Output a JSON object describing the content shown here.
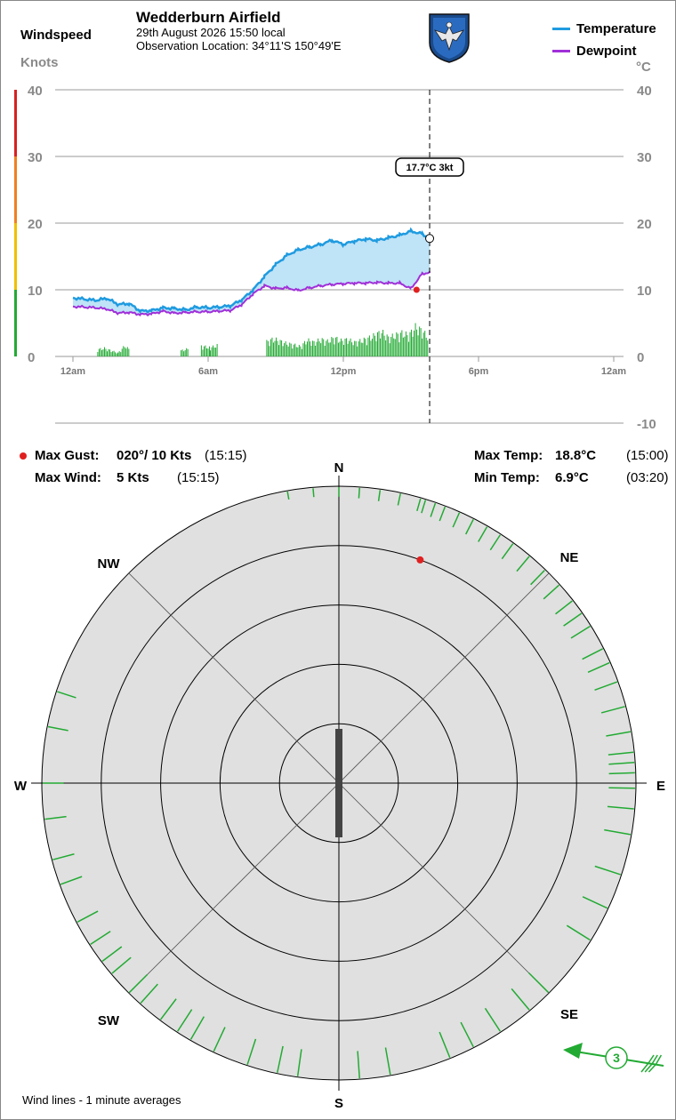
{
  "header": {
    "windspeed_label": "Windspeed",
    "knots_label": "Knots",
    "station_name": "Wedderburn Airfield",
    "date_time": "29th August 2026  15:50 local",
    "location": "Observation Location: 34°11'S 150°49'E",
    "logo_icon": "eagle-emblem-icon"
  },
  "legend": [
    {
      "name": "Temperature",
      "color": "#1f9be0"
    },
    {
      "name": "Dewpoint",
      "color": "#a030d8"
    }
  ],
  "colors": {
    "temperature": "#1f9be0",
    "dewpoint": "#a030d8",
    "fill": "#bfe3f7",
    "wind_bars": "#22aa33",
    "gust": "#e02020",
    "scale_green": "#22aa33",
    "scale_yellow": "#f0c000",
    "scale_orange": "#f08020",
    "scale_red": "#d82020"
  },
  "chart_data": {
    "type": "line",
    "left_axis": {
      "label": "Knots",
      "range": [
        0,
        40
      ],
      "ticks": [
        "0",
        "10",
        "20",
        "30",
        "40"
      ]
    },
    "right_axis": {
      "unit": "°C",
      "range": [
        -10,
        40
      ],
      "ticks": [
        "-10",
        "0",
        "10",
        "20",
        "30",
        "40"
      ]
    },
    "x_ticks": [
      "12am",
      "6am",
      "12pm",
      "6pm",
      "12am"
    ],
    "x_tick_hours": [
      0,
      6,
      12,
      18,
      24
    ],
    "current_hour": 15.83,
    "tooltip": "17.7°C  3kt",
    "grid": true,
    "series": [
      {
        "name": "Temperature",
        "points": [
          [
            0,
            8.8
          ],
          [
            0.5,
            8.6
          ],
          [
            1,
            8.4
          ],
          [
            1.5,
            8.7
          ],
          [
            2,
            7.8
          ],
          [
            2.5,
            7.9
          ],
          [
            3,
            6.8
          ],
          [
            3.5,
            6.9
          ],
          [
            4,
            7.3
          ],
          [
            4.5,
            7.2
          ],
          [
            5,
            7.0
          ],
          [
            5.5,
            7.4
          ],
          [
            6,
            7.3
          ],
          [
            6.5,
            7.4
          ],
          [
            7,
            7.6
          ],
          [
            7.5,
            8.5
          ],
          [
            8,
            10.0
          ],
          [
            8.5,
            12.0
          ],
          [
            9,
            13.8
          ],
          [
            9.5,
            15.2
          ],
          [
            10,
            16.0
          ],
          [
            10.5,
            16.4
          ],
          [
            11,
            16.8
          ],
          [
            11.5,
            17.4
          ],
          [
            12,
            16.8
          ],
          [
            12.5,
            17.3
          ],
          [
            13,
            17.6
          ],
          [
            13.5,
            17.4
          ],
          [
            14,
            17.8
          ],
          [
            14.5,
            18.2
          ],
          [
            15,
            18.8
          ],
          [
            15.5,
            18.4
          ],
          [
            15.83,
            17.7
          ]
        ]
      },
      {
        "name": "Dewpoint",
        "points": [
          [
            0,
            7.5
          ],
          [
            0.5,
            7.4
          ],
          [
            1,
            7.3
          ],
          [
            1.5,
            7.1
          ],
          [
            2,
            6.5
          ],
          [
            2.5,
            6.6
          ],
          [
            3,
            6.3
          ],
          [
            3.5,
            6.4
          ],
          [
            4,
            6.8
          ],
          [
            4.5,
            6.5
          ],
          [
            5,
            6.6
          ],
          [
            5.5,
            6.7
          ],
          [
            6,
            6.7
          ],
          [
            6.5,
            6.8
          ],
          [
            7,
            6.9
          ],
          [
            7.5,
            7.8
          ],
          [
            8,
            9.4
          ],
          [
            8.5,
            10.6
          ],
          [
            9,
            10.2
          ],
          [
            9.5,
            10.3
          ],
          [
            10,
            9.9
          ],
          [
            10.5,
            10.3
          ],
          [
            11,
            10.6
          ],
          [
            11.5,
            10.8
          ],
          [
            12,
            10.9
          ],
          [
            12.5,
            11.0
          ],
          [
            13,
            11.0
          ],
          [
            13.5,
            11.1
          ],
          [
            14,
            11.0
          ],
          [
            14.5,
            11.0
          ],
          [
            15,
            10.2
          ],
          [
            15.5,
            12.4
          ],
          [
            15.83,
            12.6
          ]
        ]
      },
      {
        "name": "Wind",
        "points": [
          [
            1.1,
            1.2
          ],
          [
            1.4,
            1.4
          ],
          [
            1.7,
            1.0
          ],
          [
            2.0,
            0.6
          ],
          [
            2.3,
            1.8
          ],
          [
            2.5,
            1.2
          ],
          [
            4.8,
            1.0
          ],
          [
            5.1,
            1.3
          ],
          [
            5.7,
            1.8
          ],
          [
            6.1,
            1.5
          ],
          [
            6.4,
            1.9
          ],
          [
            8.6,
            2.5
          ],
          [
            8.9,
            3.0
          ],
          [
            9.2,
            2.6
          ],
          [
            9.5,
            2.2
          ],
          [
            9.8,
            2.0
          ],
          [
            10.1,
            1.7
          ],
          [
            10.4,
            2.8
          ],
          [
            10.7,
            2.4
          ],
          [
            11,
            2.9
          ],
          [
            11.3,
            2.6
          ],
          [
            11.6,
            3.2
          ],
          [
            11.9,
            2.7
          ],
          [
            12.2,
            2.9
          ],
          [
            12.5,
            2.4
          ],
          [
            12.8,
            2.7
          ],
          [
            13.1,
            3.1
          ],
          [
            13.4,
            3.6
          ],
          [
            13.7,
            4.2
          ],
          [
            14.0,
            3.2
          ],
          [
            14.3,
            3.6
          ],
          [
            14.6,
            4.0
          ],
          [
            14.9,
            3.6
          ],
          [
            15.2,
            5.0
          ],
          [
            15.5,
            4.4
          ],
          [
            15.75,
            3.3
          ]
        ]
      }
    ],
    "gust_point": [
      15.25,
      10
    ],
    "stats": {
      "max_gust_label": "Max Gust:",
      "max_gust_value": "020°/ 10 Kts",
      "max_gust_time": "(15:15)",
      "max_wind_label": "Max Wind:",
      "max_wind_value": "5 Kts",
      "max_wind_time": "(15:15)",
      "max_temp_label": "Max Temp:",
      "max_temp_value": "18.8°C",
      "max_temp_time": "(15:00)",
      "min_temp_label": "Min Temp:",
      "min_temp_value": "6.9°C",
      "min_temp_time": "(03:20)"
    },
    "compass": {
      "labels": {
        "n": "N",
        "ne": "NE",
        "e": "E",
        "se": "SE",
        "s": "S",
        "sw": "SW",
        "w": "W",
        "nw": "NW"
      },
      "rings_knots": [
        2,
        4,
        6,
        8,
        10
      ],
      "gust_direction_deg": 20,
      "gust_speed_kts": 10,
      "current_direction_deg": 0,
      "wind_line_directions_deg": [
        350,
        355,
        0,
        4,
        8,
        12,
        16,
        17,
        19,
        21,
        24,
        27,
        30,
        33,
        36,
        40,
        44,
        48,
        52,
        55,
        58,
        63,
        66,
        70,
        75,
        80,
        84,
        86,
        88,
        91,
        95,
        100,
        108,
        115,
        122,
        135,
        140,
        147,
        153,
        158,
        170,
        176,
        188,
        192,
        198,
        205,
        210,
        213,
        217,
        222,
        225,
        230,
        233,
        237,
        242,
        250,
        255,
        263,
        270,
        281,
        288
      ],
      "current_speed_kts": 3,
      "note": "Wind lines - 1 minute averages"
    }
  }
}
